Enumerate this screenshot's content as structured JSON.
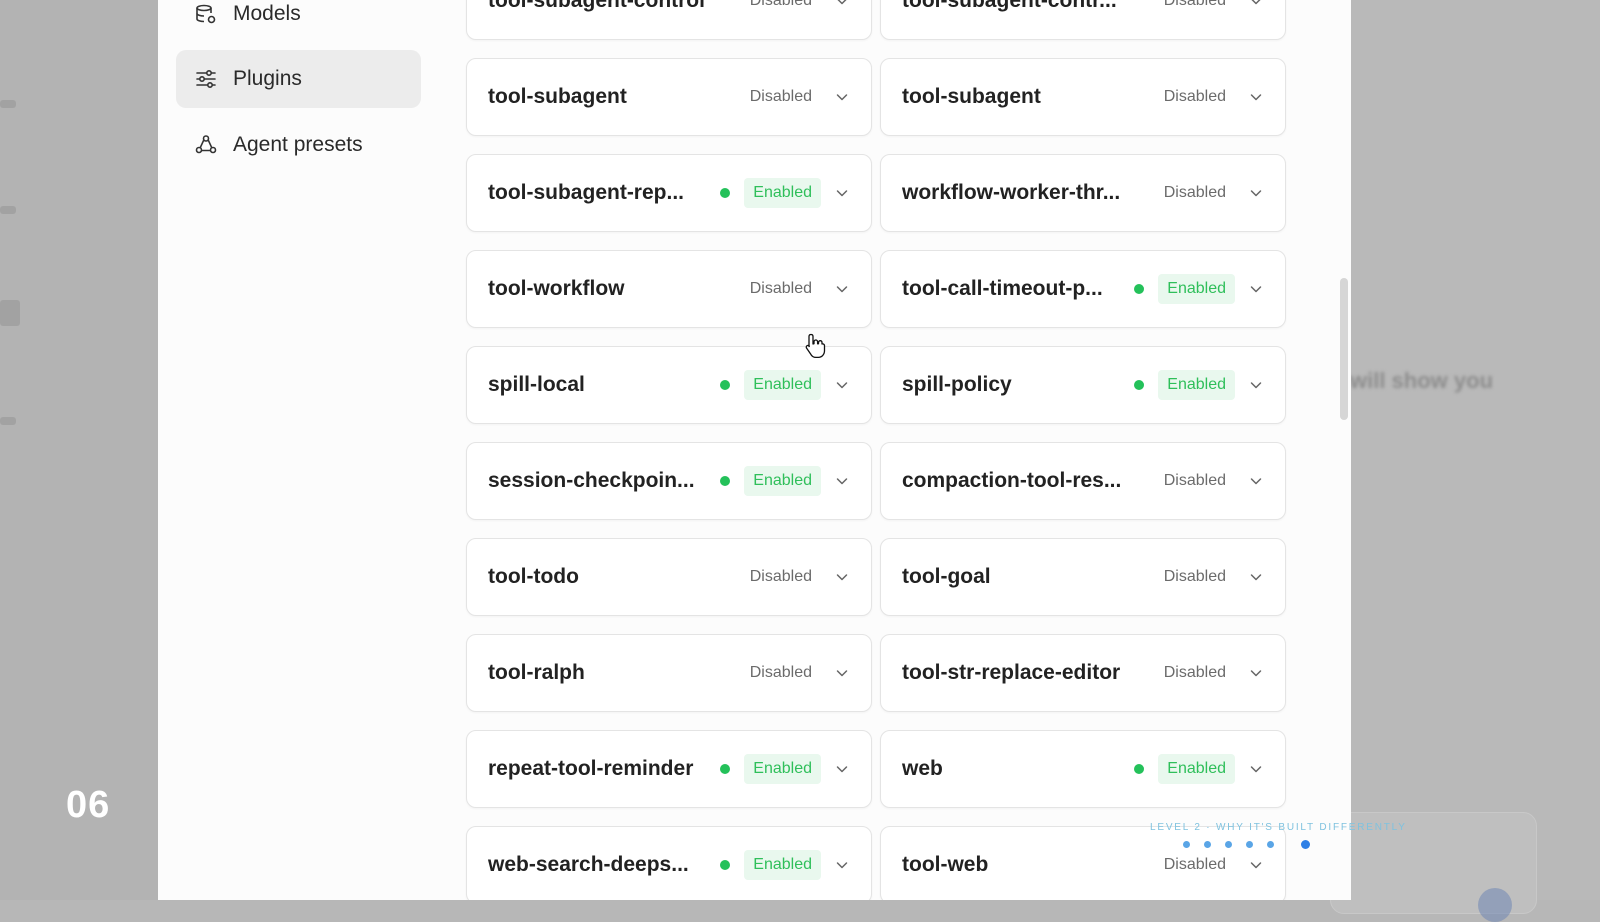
{
  "background": {
    "slide_number": "06",
    "ghost_text": "will show you"
  },
  "sidebar": {
    "items": [
      {
        "label": "Models",
        "icon": "database-gear-icon",
        "active": false
      },
      {
        "label": "Plugins",
        "icon": "sliders-icon",
        "active": true
      },
      {
        "label": "Agent presets",
        "icon": "agent-presets-icon",
        "active": false
      }
    ]
  },
  "plugins": [
    {
      "name": "tool-subagent-control",
      "status": "Disabled"
    },
    {
      "name": "tool-subagent-contr...",
      "status": "Disabled"
    },
    {
      "name": "tool-subagent",
      "status": "Disabled"
    },
    {
      "name": "tool-subagent",
      "status": "Disabled"
    },
    {
      "name": "tool-subagent-rep...",
      "status": "Enabled"
    },
    {
      "name": "workflow-worker-thr...",
      "status": "Disabled"
    },
    {
      "name": "tool-workflow",
      "status": "Disabled"
    },
    {
      "name": "tool-call-timeout-p...",
      "status": "Enabled"
    },
    {
      "name": "spill-local",
      "status": "Enabled"
    },
    {
      "name": "spill-policy",
      "status": "Enabled"
    },
    {
      "name": "session-checkpoin...",
      "status": "Enabled"
    },
    {
      "name": "compaction-tool-res...",
      "status": "Disabled"
    },
    {
      "name": "tool-todo",
      "status": "Disabled"
    },
    {
      "name": "tool-goal",
      "status": "Disabled"
    },
    {
      "name": "tool-ralph",
      "status": "Disabled"
    },
    {
      "name": "tool-str-replace-editor",
      "status": "Disabled"
    },
    {
      "name": "repeat-tool-reminder",
      "status": "Enabled"
    },
    {
      "name": "web",
      "status": "Enabled"
    },
    {
      "name": "web-search-deeps...",
      "status": "Enabled"
    },
    {
      "name": "tool-web",
      "status": "Disabled"
    }
  ],
  "colors": {
    "enabled_text": "#2fbf5a",
    "enabled_bg": "#e9f8ee",
    "enabled_dot": "#24c15a",
    "disabled_text": "#6b6b6b"
  },
  "progress": {
    "caption": "LEVEL 2 · WHY IT'S BUILT DIFFERENTLY",
    "total": 6,
    "current": 6
  }
}
